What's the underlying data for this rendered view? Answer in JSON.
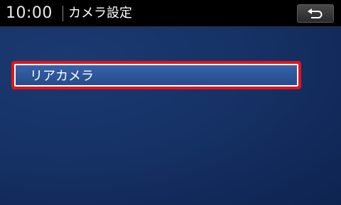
{
  "header": {
    "time": "10:00",
    "title": "カメラ設定",
    "back_icon": "return-arrow-icon"
  },
  "menu": {
    "items": [
      {
        "label": "リアカメラ"
      }
    ]
  },
  "colors": {
    "header_bg": "#000000",
    "background": "#163266",
    "selection_border": "#e0151c",
    "item_fill": "#2d5599"
  }
}
